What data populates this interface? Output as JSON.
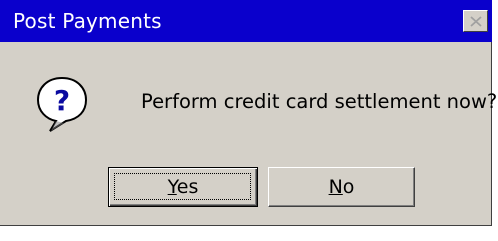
{
  "window": {
    "title": "Post Payments",
    "titlebar_color": "#0a00cc",
    "background_color": "#d4d0c8"
  },
  "close_button": {
    "icon": "close-icon"
  },
  "dialog": {
    "icon": "question-icon",
    "message": "Perform credit card settlement now?"
  },
  "buttons": {
    "yes": {
      "mnemonic": "Y",
      "rest": "es",
      "focused": true
    },
    "no": {
      "mnemonic": "N",
      "rest": "o"
    }
  }
}
